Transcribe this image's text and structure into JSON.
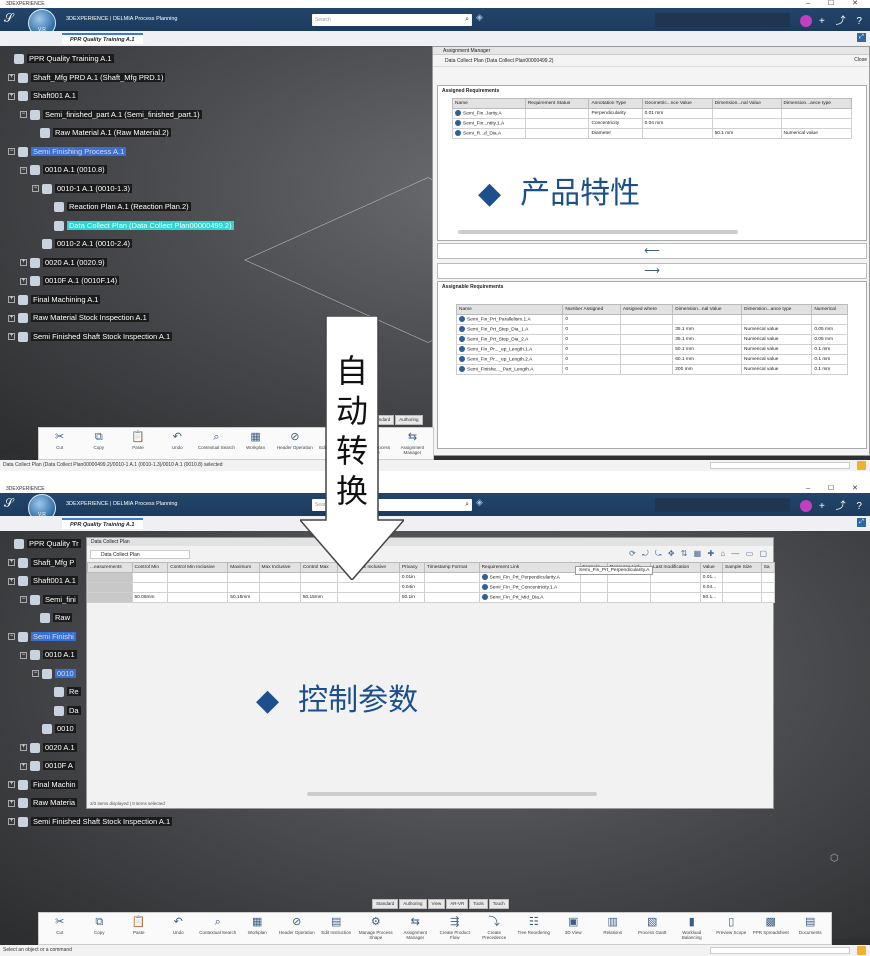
{
  "app": {
    "window_title": "3DEXPERIENCE",
    "brand": "3DEXPERIENCE | DELMIA Process Planning",
    "tab_label": "PPR Quality Training A.1",
    "search_placeholder": "Search",
    "compass_label": "V.R"
  },
  "tree_top": [
    {
      "label": "PPR Quality Training A.1",
      "pm": "",
      "style": ""
    },
    {
      "label": "Shaft_Mfg PRD A.1 (Shaft_Mfg PRD.1)",
      "pm": "+",
      "style": ""
    },
    {
      "label": "Shaft001 A.1",
      "pm": "+",
      "style": ""
    },
    {
      "label": "Semi_finished_part A.1 (Semi_finished_part.1)",
      "pm": "−",
      "style": ""
    },
    {
      "label": "Raw Material A.1 (Raw Material.2)",
      "pm": "",
      "style": ""
    },
    {
      "label": "Semi Finishing Process A.1",
      "pm": "−",
      "style": "sel"
    },
    {
      "label": "0010 A.1 (0010.8)",
      "pm": "−",
      "style": ""
    },
    {
      "label": "0010-1 A.1 (0010-1.3)",
      "pm": "−",
      "style": ""
    },
    {
      "label": "Reaction Plan A.1 (Reaction Plan.2)",
      "pm": "",
      "style": ""
    },
    {
      "label": "Data Collect Plan (Data Collect Plan00000499.2)",
      "pm": "",
      "style": "hl"
    },
    {
      "label": "0010-2 A.1 (0010-2.4)",
      "pm": "",
      "style": ""
    },
    {
      "label": "0020 A.1 (0020.9)",
      "pm": "+",
      "style": ""
    },
    {
      "label": "0010F A.1 (0010F.14)",
      "pm": "+",
      "style": ""
    },
    {
      "label": "Final Machining A.1",
      "pm": "+",
      "style": ""
    },
    {
      "label": "Raw Material Stock Inspection A.1",
      "pm": "+",
      "style": ""
    },
    {
      "label": "Semi Finished Shaft Stock Inspection A.1",
      "pm": "+",
      "style": ""
    }
  ],
  "tree_bottom": [
    {
      "label": "PPR Quality Tr",
      "pm": "",
      "style": ""
    },
    {
      "label": "Shaft_Mfg P",
      "pm": "+",
      "style": ""
    },
    {
      "label": "Shaft001 A.1",
      "pm": "+",
      "style": ""
    },
    {
      "label": "Semi_fini",
      "pm": "−",
      "style": ""
    },
    {
      "label": "Raw",
      "pm": "",
      "style": ""
    },
    {
      "label": "Semi Finishi",
      "pm": "−",
      "style": "sel"
    },
    {
      "label": "0010 A.1",
      "pm": "−",
      "style": ""
    },
    {
      "label": "0010",
      "pm": "−",
      "style": "sel"
    },
    {
      "label": "Re",
      "pm": "",
      "style": ""
    },
    {
      "label": "Da",
      "pm": "",
      "style": ""
    },
    {
      "label": "0010",
      "pm": "",
      "style": ""
    },
    {
      "label": "0020 A.1",
      "pm": "+",
      "style": ""
    },
    {
      "label": "0010F A",
      "pm": "+",
      "style": ""
    },
    {
      "label": "Final Machin",
      "pm": "+",
      "style": ""
    },
    {
      "label": "Raw Materia",
      "pm": "+",
      "style": ""
    },
    {
      "label": "Semi Finished Shaft Stock Inspection A.1",
      "pm": "+",
      "style": ""
    }
  ],
  "assignment_manager": {
    "title": "Assignment Manager",
    "subtitle": "Data Collect Plan (Data Collect Plan00000499.2)",
    "close_label": "Close",
    "assigned_label": "Assigned Requirements",
    "assigned_columns": [
      "Name",
      "Requirement Status",
      "Annotation Type",
      "Geometric...nce Value",
      "Dimension...nal Value",
      "Dimension...ance type"
    ],
    "assigned_rows": [
      [
        "Semi_Fin...larity.A",
        "",
        "Perpendicularity",
        "0.01 mm",
        "",
        ""
      ],
      [
        "Semi_Fin...ntity.1.A",
        "",
        "Concentricity",
        "0.04 mm",
        "",
        ""
      ],
      [
        "Semi_R...d_Dia.A",
        "",
        "Diameter",
        "",
        "50.1 mm",
        "Numerical value"
      ]
    ],
    "assignable_label": "Assignable Requirements",
    "assignable_columns": [
      "Name",
      "Number Assigned",
      "Assigned where",
      "Dimension...nal Value",
      "Dimension...ance type",
      "Numerical"
    ],
    "assignable_rows": [
      [
        "Semi_Fin_Prt_Parallelism.1.A",
        "0",
        "",
        "",
        "",
        ""
      ],
      [
        "Semi_Fin_Prt_Step_Dia_1.A",
        "0",
        "",
        "35.1 mm",
        "Numerical value",
        "0.05 mm"
      ],
      [
        "Semi_Fin_Prt_Step_Dia_2.A",
        "0",
        "",
        "35.1 mm",
        "Numerical value",
        "0.05 mm"
      ],
      [
        "Semi_Fin_Pr..._ep_Length.1.A",
        "0",
        "",
        "50.1 mm",
        "Numerical value",
        "0.1 mm"
      ],
      [
        "Semi_Fin_Pr..._ep_Length.2.A",
        "0",
        "",
        "60.1 mm",
        "Numerical value",
        "0.1 mm"
      ],
      [
        "Semi_Finishe..._Part_Length.A",
        "0",
        "",
        "200 mm",
        "Numerical value",
        "0.1 mm"
      ]
    ]
  },
  "callouts": {
    "product": "产品特性",
    "control": "控制参数",
    "auto_convert": [
      "自",
      "动",
      "转",
      "换"
    ]
  },
  "data_collect_plan": {
    "title": "Data Collect Plan",
    "subtitle": "Data Collect Plan",
    "columns": [
      "...easurements",
      "Control Min",
      "Control Min Inclusive",
      "Maximum",
      "Max Inclusive",
      "Control Max",
      "Control Max Inclusive",
      "Privacy",
      "Timestamp Format",
      "Requirement Link",
      "Formula",
      "Resource Link",
      "Last modification",
      "Value",
      "Sample Size",
      "Sa"
    ],
    "rows": [
      [
        "",
        "",
        "",
        "",
        "",
        "",
        "",
        "0.01in",
        "",
        "Semi_Fin_Prt_Perpendicularity.A",
        "",
        "",
        "",
        "0.01...",
        "",
        ""
      ],
      [
        "",
        "",
        "",
        "",
        "",
        "",
        "",
        "0.04in",
        "",
        "Semi_Fin_Prt_Concentricity.1.A",
        "",
        "",
        "",
        "0.04...",
        "",
        ""
      ],
      [
        "",
        "50.05mm",
        "",
        "50.15mm",
        "",
        "50.15mm",
        "",
        "50.1in",
        "",
        "Semi_Fin_Prt_Mid_Dia.A",
        "",
        "",
        "",
        "50.1...",
        "",
        ""
      ]
    ],
    "tooltip": "Semi_Fin_Prt_Perpendicularity.A",
    "footer": "3/3 items displayed | 0 items selected"
  },
  "status": {
    "top": "Data Collect Plan (Data Collect Plan00000499.2)/0010-1 A.1 (0010-1.3)/0010 A.1 (0010.8) selected",
    "bottom": "Select an object or a command"
  },
  "actionbar_top": [
    {
      "icon": "cut-icon",
      "glyph": "✂",
      "label": "Cut"
    },
    {
      "icon": "copy-icon",
      "glyph": "⧉",
      "label": "Copy"
    },
    {
      "icon": "paste-icon",
      "glyph": "📋",
      "label": "Paste"
    },
    {
      "icon": "undo-icon",
      "glyph": "↶",
      "label": "Undo"
    },
    {
      "icon": "search-icon",
      "glyph": "⌕",
      "label": "Contextual Search"
    },
    {
      "icon": "workplan-icon",
      "glyph": "▦",
      "label": "Workplan"
    },
    {
      "icon": "header-icon",
      "glyph": "⊘",
      "label": "Header Operation"
    },
    {
      "icon": "edit-icon",
      "glyph": "▤",
      "label": "Edit Instruction"
    },
    {
      "icon": "manage-icon",
      "glyph": "⚙",
      "label": "Manage Process Shape"
    },
    {
      "icon": "assign-icon",
      "glyph": "⇆",
      "label": "Assignment Manager"
    }
  ],
  "actionbar_bottom": [
    {
      "icon": "cut-icon",
      "glyph": "✂",
      "label": "Cut"
    },
    {
      "icon": "copy-icon",
      "glyph": "⧉",
      "label": "Copy"
    },
    {
      "icon": "paste-icon",
      "glyph": "📋",
      "label": "Paste"
    },
    {
      "icon": "undo-icon",
      "glyph": "↶",
      "label": "Undo"
    },
    {
      "icon": "search-icon",
      "glyph": "⌕",
      "label": "Contextual Search"
    },
    {
      "icon": "workplan-icon",
      "glyph": "▦",
      "label": "Workplan"
    },
    {
      "icon": "header-icon",
      "glyph": "⊘",
      "label": "Header Operation"
    },
    {
      "icon": "edit-icon",
      "glyph": "▤",
      "label": "Edit Instruction"
    },
    {
      "icon": "manage-icon",
      "glyph": "⚙",
      "label": "Manage Process Shape"
    },
    {
      "icon": "assign-icon",
      "glyph": "⇆",
      "label": "Assignment Manager"
    },
    {
      "icon": "create-flow-icon",
      "glyph": "⇶",
      "label": "Create Product Flow"
    },
    {
      "icon": "precedence-icon",
      "glyph": "⤵",
      "label": "Create Precedence"
    },
    {
      "icon": "tree-icon",
      "glyph": "☷",
      "label": "Tree Reordering"
    },
    {
      "icon": "3d-view-icon",
      "glyph": "▣",
      "label": "3D View"
    },
    {
      "icon": "relations-icon",
      "glyph": "▥",
      "label": "Relations"
    },
    {
      "icon": "process-gantt-icon",
      "glyph": "▧",
      "label": "Process Gantt"
    },
    {
      "icon": "workload-icon",
      "glyph": "▮",
      "label": "Workload Balancing"
    },
    {
      "icon": "preview-icon",
      "glyph": "▯",
      "label": "Preview Scope"
    },
    {
      "icon": "ppr-icon",
      "glyph": "▩",
      "label": "PPR Spreadsheet"
    },
    {
      "icon": "documents-icon",
      "glyph": "▤",
      "label": "Documents"
    }
  ],
  "action_tabs": [
    "Standard",
    "Authoring",
    "View",
    "AR-VR",
    "Tools",
    "Touch"
  ]
}
